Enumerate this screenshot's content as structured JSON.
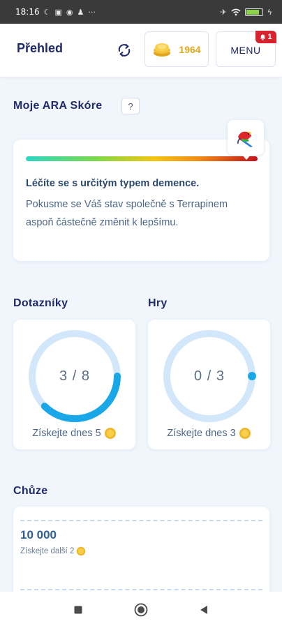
{
  "status_bar": {
    "time": "18:16",
    "extra": "···"
  },
  "header": {
    "title": "Přehled",
    "coins": "1964",
    "menu_label": "MENU",
    "menu_badge_count": "1"
  },
  "ara_score": {
    "title": "Moje ARA Skóre",
    "help_label": "?",
    "level_fraction": 0.95,
    "heading": "Léčíte se s určitým typem demence.",
    "description": "Pokusme se Váš stav společně s Terrapinem aspoň částečně změnit k lepšímu."
  },
  "questionnaires": {
    "title": "Dotazníky",
    "completed": 3,
    "total": 8,
    "value_text": "3 / 8",
    "earn_text": "Získejte dnes 5"
  },
  "games": {
    "title": "Hry",
    "completed": 0,
    "total": 3,
    "value_text": "0 / 3",
    "earn_text": "Získejte dnes 3"
  },
  "walking": {
    "title": "Chůze",
    "steps_goal": "10 000",
    "earn_text": "Získejte další 2"
  },
  "colors": {
    "accent_navy": "#1f2a6b",
    "coin_gold": "#e1a81c",
    "ring_track": "#d3e7fb",
    "ring_fill": "#1aa7e8",
    "badge_red": "#d6232e"
  },
  "icons": {
    "refresh": "refresh-icon",
    "coins": "coin-stack-icon",
    "bell": "bell-icon",
    "parrot": "parrot-icon",
    "coin": "coin-icon"
  }
}
